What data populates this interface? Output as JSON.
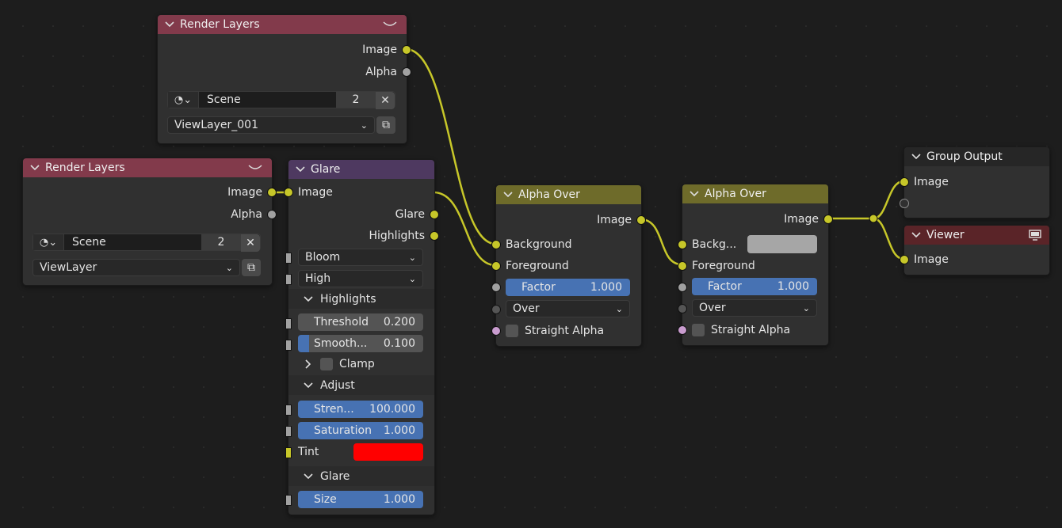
{
  "rl1": {
    "title": "Render Layers",
    "out_image": "Image",
    "out_alpha": "Alpha",
    "scene": "Scene",
    "users": "2",
    "viewlayer": "ViewLayer_001"
  },
  "rl2": {
    "title": "Render Layers",
    "out_image": "Image",
    "out_alpha": "Alpha",
    "scene": "Scene",
    "users": "2",
    "viewlayer": "ViewLayer"
  },
  "glare": {
    "title": "Glare",
    "in_image": "Image",
    "out_glare": "Glare",
    "out_highlights": "Highlights",
    "type": "Bloom",
    "quality": "High",
    "panel_highlights": "Highlights",
    "threshold_label": "Threshold",
    "threshold_value": "0.200",
    "smooth_label": "Smooth...",
    "smooth_value": "0.100",
    "clamp": "Clamp",
    "panel_adjust": "Adjust",
    "strength_label": "Stren...",
    "strength_value": "100.000",
    "saturation_label": "Saturation",
    "saturation_value": "1.000",
    "tint": "Tint",
    "tint_color": "#ff0000",
    "panel_glare": "Glare",
    "size_label": "Size",
    "size_value": "1.000"
  },
  "ao1": {
    "title": "Alpha Over",
    "out_image": "Image",
    "background": "Background",
    "foreground": "Foreground",
    "factor_label": "Factor",
    "factor_value": "1.000",
    "mode": "Over",
    "straight_alpha": "Straight Alpha"
  },
  "ao2": {
    "title": "Alpha Over",
    "out_image": "Image",
    "background": "Backg...",
    "foreground": "Foreground",
    "factor_label": "Factor",
    "factor_value": "1.000",
    "mode": "Over",
    "straight_alpha": "Straight Alpha"
  },
  "group_output": {
    "title": "Group Output",
    "in_image": "Image"
  },
  "viewer": {
    "title": "Viewer",
    "in_image": "Image"
  },
  "colors": {
    "wire": "#c7c729",
    "render_layers_header": "#823a4b",
    "glare_header": "#4e3960",
    "alpha_over_header": "#6e6b2a",
    "viewer_header": "#5a2428",
    "slider": "#4772b3"
  }
}
